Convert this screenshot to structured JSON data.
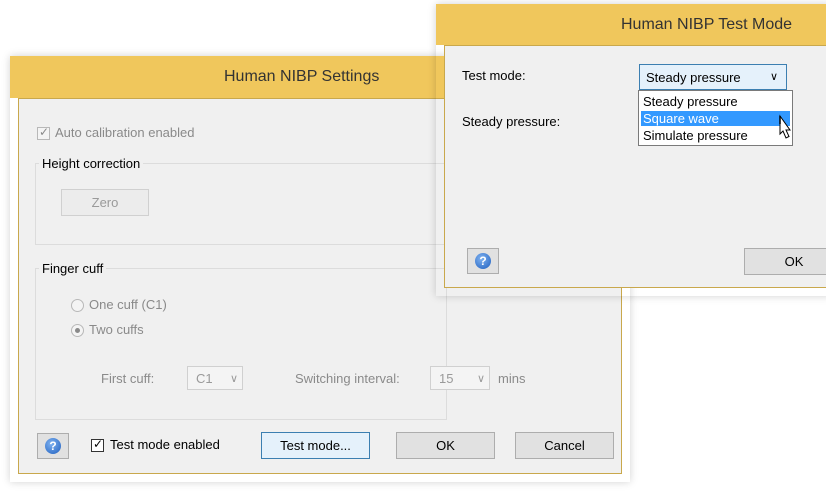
{
  "settings": {
    "title": "Human NIBP Settings",
    "auto_calibration_label": "Auto calibration enabled",
    "auto_calibration_checked": true,
    "height_group_label": "Height correction",
    "zero_button": "Zero",
    "finger_group_label": "Finger cuff",
    "one_cuff_label": "One cuff (C1)",
    "two_cuffs_label": "Two cuffs",
    "selected_cuff_option": "Two cuffs",
    "first_cuff_label": "First cuff:",
    "first_cuff_value": "C1",
    "switching_label": "Switching interval:",
    "switching_value": "15",
    "mins_label": "mins",
    "help_glyph": "?",
    "test_mode_enabled_label": "Test mode enabled",
    "test_mode_enabled_checked": true,
    "test_mode_button": "Test mode...",
    "ok_button": "OK",
    "cancel_button": "Cancel"
  },
  "test_mode": {
    "title": "Human NIBP Test Mode",
    "test_mode_label": "Test mode:",
    "test_mode_value": "Steady pressure",
    "steady_pressure_label": "Steady pressure:",
    "dropdown_options": [
      "Steady pressure",
      "Square wave",
      "Simulate pressure"
    ],
    "highlighted_option": "Square wave",
    "help_glyph": "?",
    "ok_button": "OK"
  },
  "icons": {
    "help": "help-icon",
    "chevron": "chevron-down-icon",
    "check": "checkmark-icon",
    "cursor": "mouse-pointer-icon"
  },
  "colors": {
    "titlebar": "#f0c75c",
    "dialog_bg": "#f0f0f0",
    "highlight": "#3399ff"
  }
}
